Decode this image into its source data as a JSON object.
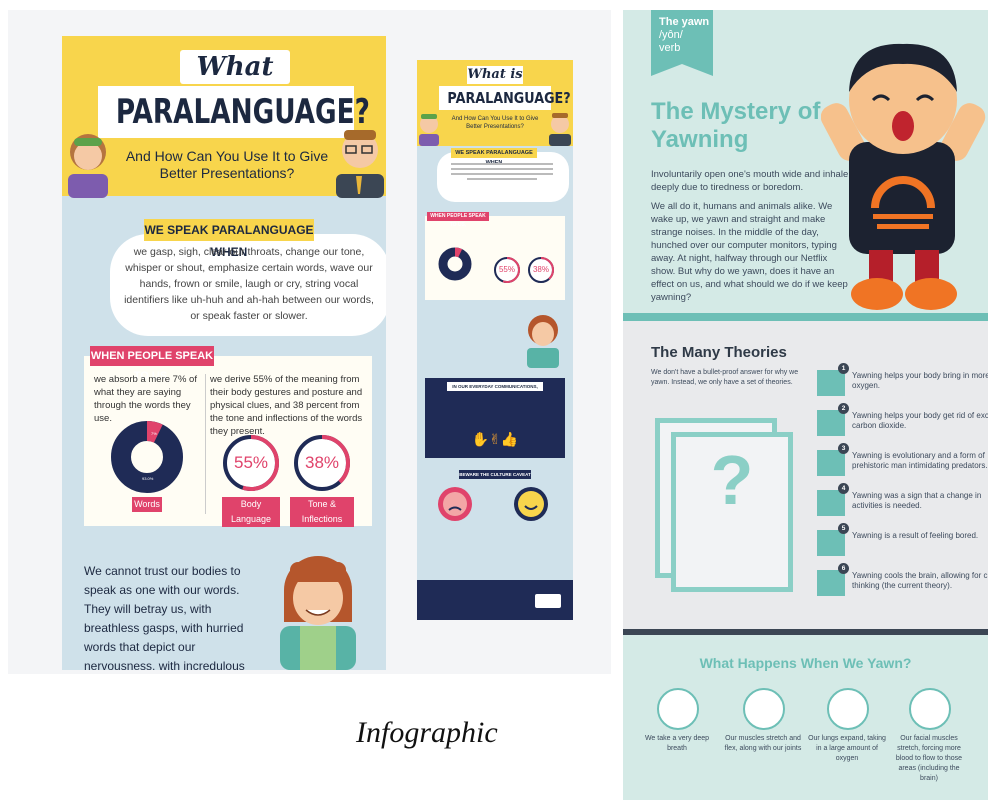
{
  "caption": "Infographic",
  "left_infographic": {
    "what_is": "What is",
    "title": "PARALANGUAGE?",
    "subtitle": "And How Can You Use It to Give Better Presentations?",
    "speak_heading": "WE SPEAK PARALANGUAGE WHEN",
    "speak_text": "we gasp, sigh, clear our throats, change our tone, whisper or shout, emphasize certain words, wave our hands, frown or smile, laugh or cry, string vocal identifiers like uh-huh and ah-hah between our words, or speak faster or slower.",
    "when_heading": "WHEN PEOPLE SPEAK TO US,",
    "absorb_text": "we absorb a mere 7% of what they are saying through the words they use.",
    "derive_text": "we derive 55% of the meaning from their body gestures and posture and physical clues, and 38 percent from the tone and inflections of the words they present.",
    "donut_label": "Words",
    "donut_value": "93.0%",
    "donut_small_pct": "7%",
    "body_pct": "55%",
    "body_label": "Body Language",
    "tone_pct": "38%",
    "tone_label": "Tone & Inflections",
    "bottom_text": "We cannot trust our bodies to speak as one with our words. They will betray us, with breathless gasps, with hurried words that depict our nervousness, with incredulous expressions even while we nod agreement."
  },
  "mini_infographic": {
    "what_is": "What is",
    "title": "PARALANGUAGE?",
    "subtitle": "And How Can You Use It to Give Better Presentations?",
    "speak_heading": "WE SPEAK PARALANGUAGE WHEN",
    "when_heading": "WHEN PEOPLE SPEAK TO US,",
    "body_pct": "55%",
    "tone_pct": "38%",
    "everyday_heading": "IN OUR EVERYDAY COMMUNICATIONS,",
    "caveat_heading": "BEWARE THE CULTURE CAVEAT"
  },
  "yawning": {
    "tag_word": "The yawn",
    "tag_pron": "/yôn/",
    "tag_pos": "verb",
    "title": "The Mystery of Yawning",
    "intro": "Involuntarily open one's mouth wide and inhale deeply due to tiredness or boredom.",
    "body": "We all do it, humans and animals alike. We wake up, we yawn and straight and make strange noises. In the middle of the day, hunched over our computer monitors, typing away. At night, halfway through our Netflix show. But why do we yawn, does it have an effect on us, and what should we do if we keep yawning?",
    "theories_title": "The Many Theories",
    "theories_intro": "We don't have a bullet-proof answer for why we yawn. Instead, we only have a set of theories.",
    "question_mark": "?",
    "theories": [
      {
        "num": "1",
        "text": "Yawning helps your body bring in more oxygen."
      },
      {
        "num": "2",
        "text": "Yawning helps your body get rid of excess carbon dioxide."
      },
      {
        "num": "3",
        "text": "Yawning is evolutionary and a form of prehistoric man intimidating predators."
      },
      {
        "num": "4",
        "text": "Yawning was a sign that a change in activities is needed."
      },
      {
        "num": "5",
        "text": "Yawning is a result of feeling bored."
      },
      {
        "num": "6",
        "text": "Yawning cools the brain, allowing for clear thinking (the current theory)."
      }
    ],
    "what_happens_title": "What Happens When We Yawn?",
    "steps": [
      {
        "text": "We take a very deep breath"
      },
      {
        "text": "Our muscles stretch and flex, along with our joints"
      },
      {
        "text": "Our lungs expand, taking in a large amount of oxygen"
      },
      {
        "text": "Our facial muscles stretch, forcing more blood to flow to those areas (including the brain)"
      }
    ]
  },
  "colors": {
    "yellow": "#f8d54c",
    "pink": "#e0436b",
    "navy": "#1f2b56",
    "teal": "#6dbfb6",
    "light_blue": "#cfe1ea"
  }
}
